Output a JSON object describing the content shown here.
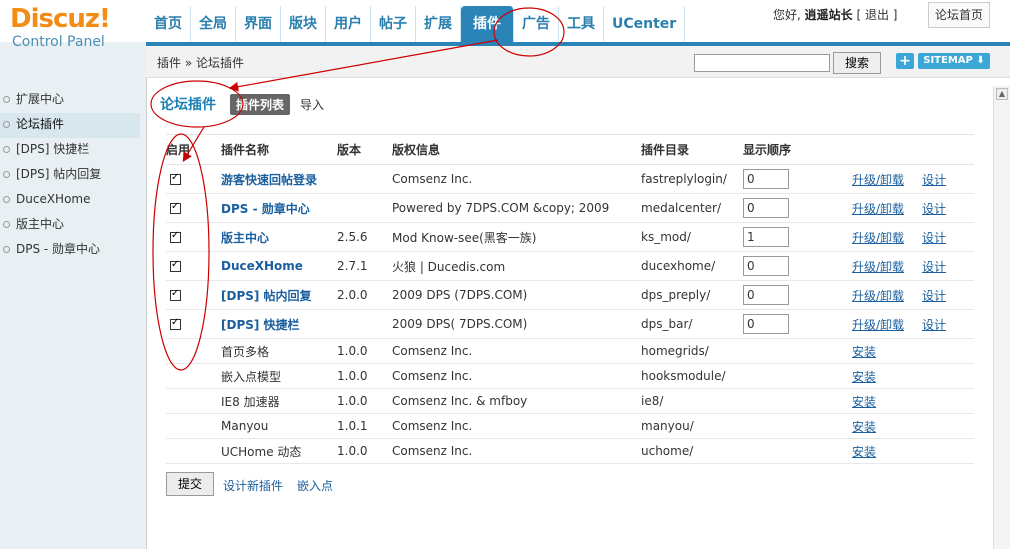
{
  "logo": {
    "line1": "Discuz!",
    "line2": "Control Panel"
  },
  "nav": {
    "tabs": [
      "首页",
      "全局",
      "界面",
      "版块",
      "用户",
      "帖子",
      "扩展",
      "插件",
      "广告",
      "工具",
      "UCenter"
    ],
    "active_index": 7
  },
  "topright": {
    "greeting": "您好,",
    "user": "逍遥站长",
    "logout": "[ 退出 ]",
    "home": "论坛首页"
  },
  "breadcrumb": "插件 » 论坛插件",
  "search": {
    "value": "",
    "button": "搜索"
  },
  "sitemap": "SITEMAP",
  "sidebar": {
    "items": [
      "扩展中心",
      "论坛插件",
      "[DPS] 快捷栏",
      "[DPS] 帖内回复",
      "DuceXHome",
      "版主中心",
      "DPS - 勋章中心"
    ],
    "active_index": 1
  },
  "page": {
    "title": "论坛插件",
    "tab_list": "插件列表",
    "tab_import": "导入"
  },
  "table": {
    "headers": [
      "启用",
      "插件名称",
      "版本",
      "版权信息",
      "插件目录",
      "显示顺序"
    ],
    "rows": [
      {
        "enabled": true,
        "name": "游客快速回帖登录",
        "version": "",
        "copyright": "Comsenz Inc.",
        "dir": "fastreplylogin/",
        "order": "0",
        "action1": "升级/卸载",
        "action2": "设计"
      },
      {
        "enabled": true,
        "name": "DPS - 勋章中心",
        "version": "",
        "copyright": "Powered by 7DPS.COM &copy; 2009",
        "dir": "medalcenter/",
        "order": "0",
        "action1": "升级/卸载",
        "action2": "设计"
      },
      {
        "enabled": true,
        "name": "版主中心",
        "version": "2.5.6",
        "copyright": "Mod Know-see(黑客一族)",
        "dir": "ks_mod/",
        "order": "1",
        "action1": "升级/卸载",
        "action2": "设计"
      },
      {
        "enabled": true,
        "name": "DuceXHome",
        "version": "2.7.1",
        "copyright": "火狼 | Ducedis.com",
        "dir": "ducexhome/",
        "order": "0",
        "action1": "升级/卸载",
        "action2": "设计"
      },
      {
        "enabled": true,
        "name": "[DPS] 帖内回复",
        "version": "2.0.0",
        "copyright": "2009 DPS (7DPS.COM)",
        "dir": "dps_preply/",
        "order": "0",
        "action1": "升级/卸载",
        "action2": "设计"
      },
      {
        "enabled": true,
        "name": "[DPS] 快捷栏",
        "version": "",
        "copyright": "2009 DPS( 7DPS.COM)",
        "dir": "dps_bar/",
        "order": "0",
        "action1": "升级/卸载",
        "action2": "设计"
      }
    ],
    "uninstalled": [
      {
        "name": "首页多格",
        "version": "1.0.0",
        "copyright": "Comsenz Inc.",
        "dir": "homegrids/",
        "action": "安装"
      },
      {
        "name": "嵌入点模型",
        "version": "1.0.0",
        "copyright": "Comsenz Inc.",
        "dir": "hooksmodule/",
        "action": "安装"
      },
      {
        "name": "IE8 加速器",
        "version": "1.0.0",
        "copyright": "Comsenz Inc. & mfboy",
        "dir": "ie8/",
        "action": "安装"
      },
      {
        "name": "Manyou",
        "version": "1.0.1",
        "copyright": "Comsenz Inc.",
        "dir": "manyou/",
        "action": "安装"
      },
      {
        "name": "UCHome 动态",
        "version": "1.0.0",
        "copyright": "Comsenz Inc.",
        "dir": "uchome/",
        "action": "安装"
      }
    ]
  },
  "footer": {
    "submit": "提交",
    "design_new": "设计新插件",
    "embed_point": "嵌入点"
  },
  "colors": {
    "accent": "#2a84b8",
    "logo": "#f28c14",
    "annotation": "#cc0000"
  }
}
